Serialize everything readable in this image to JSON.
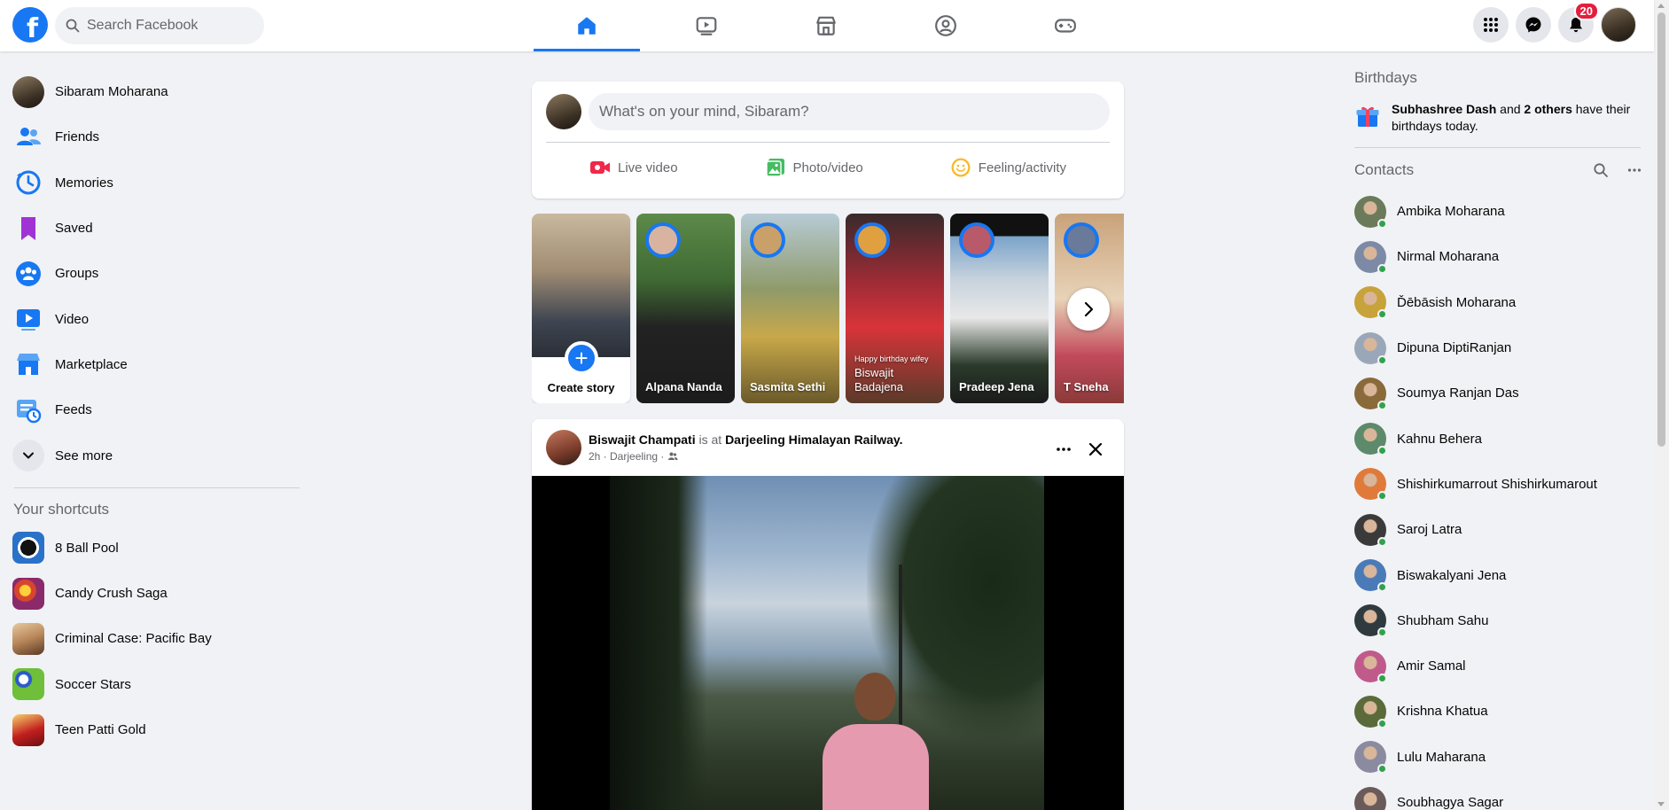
{
  "search": {
    "placeholder": "Search Facebook"
  },
  "logo": "f",
  "nav_tabs": [
    {
      "name": "home-icon",
      "active": true
    },
    {
      "name": "watch-icon",
      "active": false
    },
    {
      "name": "marketplace-icon",
      "active": false
    },
    {
      "name": "groups-icon",
      "active": false
    },
    {
      "name": "gaming-icon",
      "active": false
    }
  ],
  "header": {
    "notifications_count": "20"
  },
  "left_nav": {
    "profile_name": "Sibaram Moharana",
    "items": [
      {
        "label": "Friends",
        "icon": "friends-icon"
      },
      {
        "label": "Memories",
        "icon": "memories-icon"
      },
      {
        "label": "Saved",
        "icon": "saved-icon"
      },
      {
        "label": "Groups",
        "icon": "groups-icon"
      },
      {
        "label": "Video",
        "icon": "video-icon"
      },
      {
        "label": "Marketplace",
        "icon": "marketplace-icon"
      },
      {
        "label": "Feeds",
        "icon": "feeds-icon"
      },
      {
        "label": "See more",
        "icon": "chevron-down-icon"
      }
    ],
    "shortcuts_title": "Your shortcuts",
    "shortcuts": [
      {
        "label": "8 Ball Pool",
        "color": "#2a72c9"
      },
      {
        "label": "Candy Crush Saga",
        "color": "#d8452d"
      },
      {
        "label": "Criminal Case: Pacific Bay",
        "color": "#b8875a"
      },
      {
        "label": "Soccer Stars",
        "color": "#6fbf3a"
      },
      {
        "label": "Teen Patti Gold",
        "color": "#c21f1f"
      }
    ]
  },
  "composer": {
    "placeholder": "What's on your mind, Sibaram?",
    "actions": [
      {
        "label": "Live video",
        "icon": "live-video-icon",
        "color": "#f02849"
      },
      {
        "label": "Photo/video",
        "icon": "photo-video-icon",
        "color": "#45bd62"
      },
      {
        "label": "Feeling/activity",
        "icon": "feeling-icon",
        "color": "#f7b928"
      }
    ]
  },
  "stories": {
    "create_label": "Create story",
    "items": [
      {
        "name": "Alpana Nanda",
        "bg": "#4a6b3a"
      },
      {
        "name": "Sasmita Sethi",
        "bg": "#8f9a6a"
      },
      {
        "name": "Biswajit Badajena",
        "bg": "#9b2b36",
        "caption": "Happy birthday wifey"
      },
      {
        "name": "Pradeep Jena",
        "bg": "#1b1b1b"
      },
      {
        "name": "T Sneha",
        "bg": "#c9a27a"
      }
    ]
  },
  "post": {
    "author": "Biswajit Champati",
    "is_at": "is at",
    "place": "Darjeeling Himalayan Railway.",
    "meta": "2h · Darjeeling ·"
  },
  "right": {
    "birthdays_title": "Birthdays",
    "birthday_name": "Subhashree Dash",
    "birthday_and": "and",
    "birthday_others": "2 others",
    "birthday_rest": "have their birthdays today.",
    "contacts_title": "Contacts",
    "contacts": [
      {
        "name": "Ambika Moharana",
        "color": "#6b7a5a"
      },
      {
        "name": "Nirmal Moharana",
        "color": "#7c8aa6"
      },
      {
        "name": "Ďēbāsish Moharana",
        "color": "#c8a23a"
      },
      {
        "name": "Dipuna DiptiRanjan",
        "color": "#9aa7b8"
      },
      {
        "name": "Soumya Ranjan Das",
        "color": "#8a6a3a"
      },
      {
        "name": "Kahnu Behera",
        "color": "#5d8a6a"
      },
      {
        "name": "Shishirkumarrout Shishirkumarout",
        "color": "#e07a3a"
      },
      {
        "name": "Saroj Latra",
        "color": "#3a3a3a"
      },
      {
        "name": "Biswakalyani Jena",
        "color": "#4a7ab8"
      },
      {
        "name": "Shubham Sahu",
        "color": "#2f3a3f"
      },
      {
        "name": "Amir Samal",
        "color": "#c05a8a"
      },
      {
        "name": "Krishna Khatua",
        "color": "#5a6a3a"
      },
      {
        "name": "Lulu Maharana",
        "color": "#8a8aa0"
      },
      {
        "name": "Soubhagya Sagar",
        "color": "#6a5a5a"
      }
    ]
  }
}
